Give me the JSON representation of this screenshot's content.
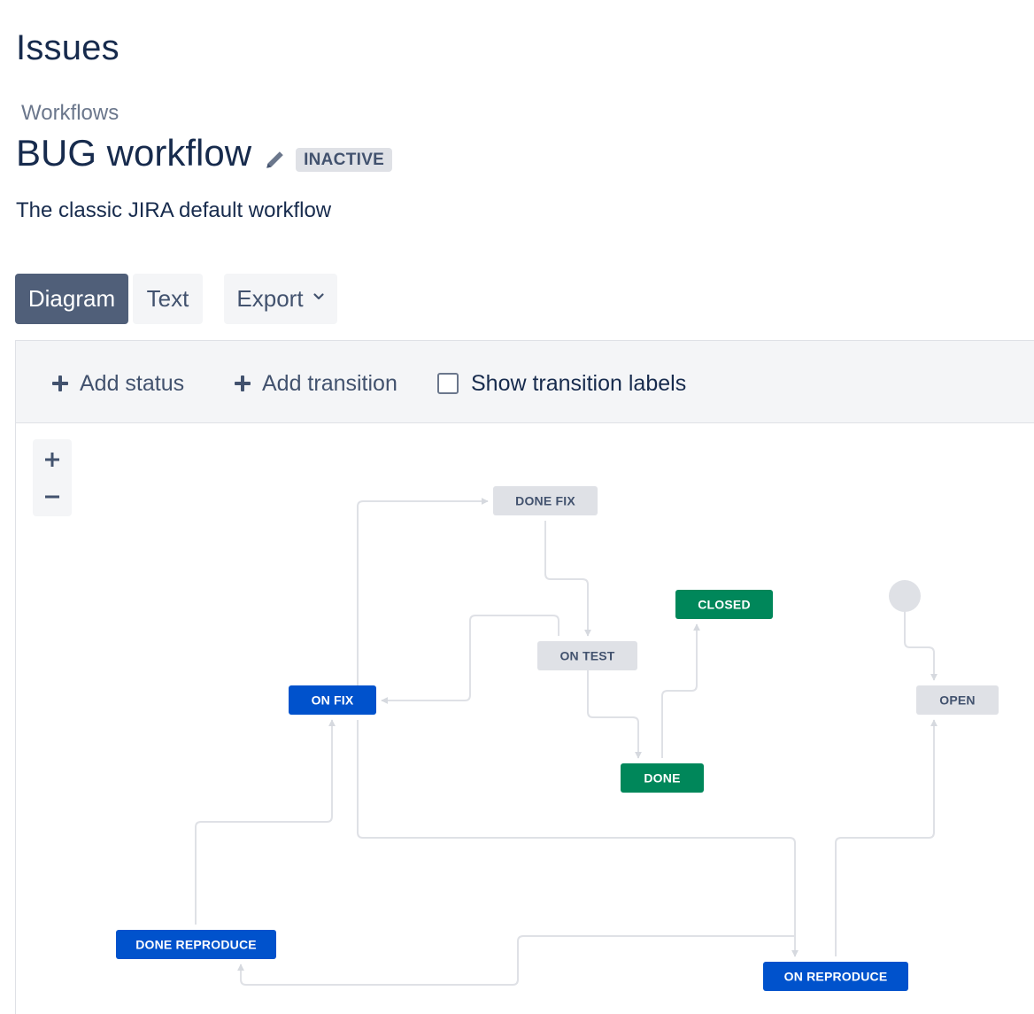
{
  "header": {
    "section_title": "Issues",
    "breadcrumb": "Workflows",
    "workflow_name": "BUG workflow",
    "status_lozenge": "INACTIVE",
    "description": "The classic JIRA default workflow"
  },
  "view_tabs": {
    "diagram": "Diagram",
    "text": "Text",
    "export": "Export"
  },
  "toolbar": {
    "add_status": "Add status",
    "add_transition": "Add transition",
    "show_labels": "Show transition labels",
    "show_labels_checked": false
  },
  "zoom": {
    "in": "+",
    "out": "−"
  },
  "colors": {
    "in_progress": "#0052cc",
    "done": "#00875a",
    "todo": "#dfe1e6",
    "edge": "#dfe1e6"
  },
  "statuses": {
    "done_fix": {
      "label": "DONE FIX",
      "category": "todo"
    },
    "closed": {
      "label": "CLOSED",
      "category": "done"
    },
    "on_test": {
      "label": "ON TEST",
      "category": "todo"
    },
    "on_fix": {
      "label": "ON FIX",
      "category": "in_progress"
    },
    "open": {
      "label": "OPEN",
      "category": "todo"
    },
    "done": {
      "label": "DONE",
      "category": "done"
    },
    "done_reproduce": {
      "label": "DONE REPRODUCE",
      "category": "in_progress"
    },
    "on_reproduce": {
      "label": "ON REPRODUCE",
      "category": "in_progress"
    }
  }
}
